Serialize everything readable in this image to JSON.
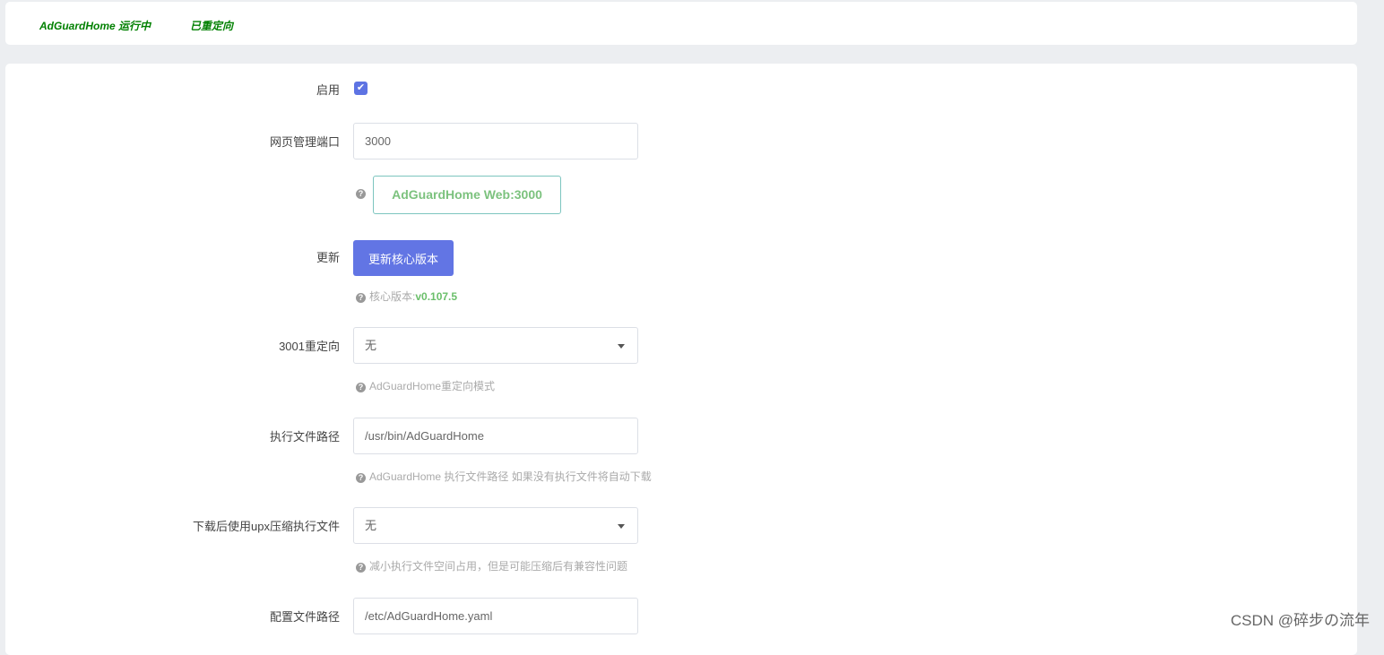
{
  "status": {
    "running": "AdGuardHome 运行中",
    "redirect": "已重定向"
  },
  "form": {
    "enable_label": "启用",
    "port_label": "网页管理端口",
    "port_value": "3000",
    "web_button": "AdGuardHome Web:3000",
    "update_label": "更新",
    "update_button": "更新核心版本",
    "version_prefix": "核心版本:",
    "version": "v0.107.5",
    "redirect_label": "3001重定向",
    "redirect_value": "无",
    "redirect_help": "AdGuardHome重定向模式",
    "bin_label": "执行文件路径",
    "bin_value": "/usr/bin/AdGuardHome",
    "bin_help": "AdGuardHome 执行文件路径 如果没有执行文件将自动下载",
    "upx_label": "下载后使用upx压缩执行文件",
    "upx_value": "无",
    "upx_help": "减小执行文件空间占用，但是可能压缩后有兼容性问题",
    "config_label": "配置文件路径",
    "config_value": "/etc/AdGuardHome.yaml"
  },
  "watermark": "CSDN @碎步の流年"
}
